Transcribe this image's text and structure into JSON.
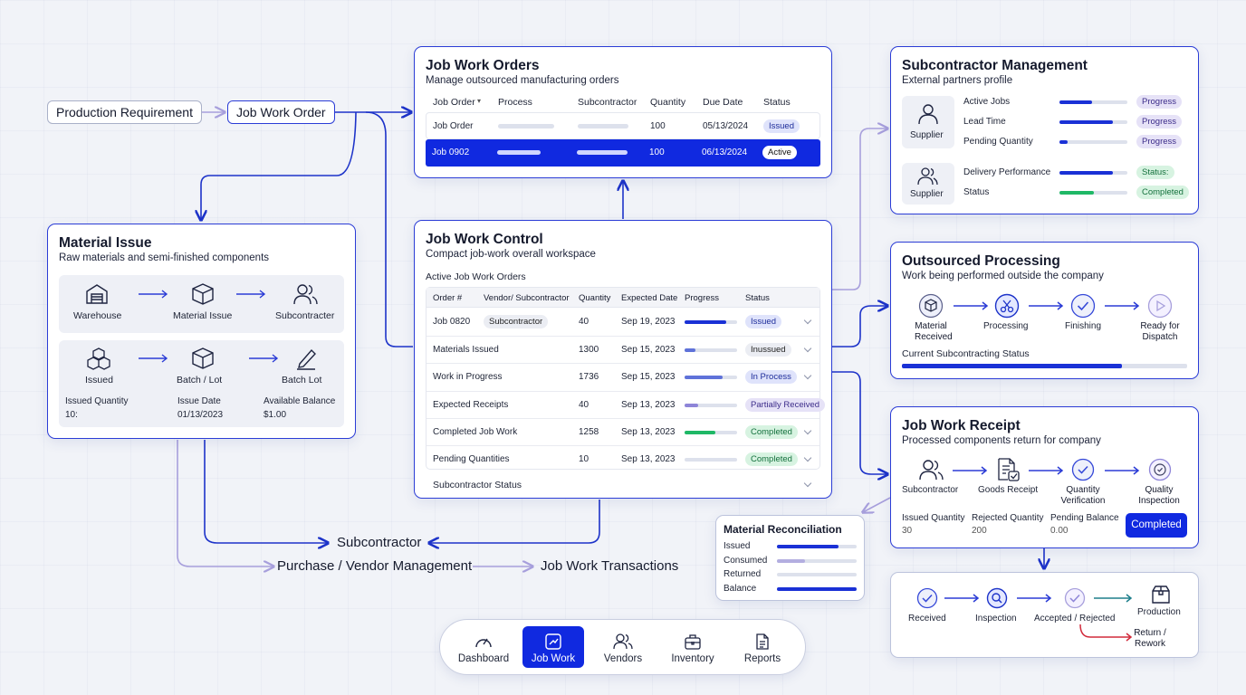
{
  "flow": {
    "production_requirement": "Production Requirement",
    "job_work_order": "Job Work Order",
    "subcontractor": "Subcontractor",
    "purchase_vendor": "Purchase / Vendor Management",
    "job_work_transactions": "Job Work Transactions"
  },
  "job_orders": {
    "title": "Job Work Orders",
    "subtitle": "Manage outsourced manufacturing orders",
    "headers": [
      "Job Order",
      "Process",
      "Subcontractor",
      "Quantity",
      "Due Date",
      "Status"
    ],
    "rows": [
      {
        "order": "Job Order",
        "qty": "100",
        "due": "05/13/2024",
        "status": "Issued"
      },
      {
        "order": "Job 0902",
        "qty": "100",
        "due": "06/13/2024",
        "status": "Active"
      }
    ]
  },
  "material_issue": {
    "title": "Material Issue",
    "subtitle": "Raw materials and semi-finished components",
    "flow1": [
      "Warehouse",
      "Material Issue",
      "Subcontracter"
    ],
    "flow2": [
      "Issued",
      "Batch / Lot",
      "Batch Lot"
    ],
    "fields": [
      {
        "label": "Issued Quantity",
        "value": "10:"
      },
      {
        "label": "Issue Date",
        "value": "01/13/2023"
      },
      {
        "label": "Available Balance",
        "value": "$1.00"
      }
    ]
  },
  "control": {
    "title": "Job Work Control",
    "subtitle": "Compact job-work overall workspace",
    "section": "Active Job Work Orders",
    "headers": [
      "Order #",
      "Vendor/ Subcontractor",
      "Quantity",
      "Expected Date",
      "Progress",
      "Status"
    ],
    "rows": [
      {
        "order": "Job 0820",
        "vendor": "Subcontractor",
        "qty": "40",
        "date": "Sep 19, 2023",
        "progress": 0.8,
        "status": "Issued"
      },
      {
        "order": "Materials Issued",
        "vendor": "",
        "qty": "1300",
        "date": "Sep 15, 2023",
        "progress": 0.2,
        "status": "Inussued"
      },
      {
        "order": "Work in Progress",
        "vendor": "",
        "qty": "1736",
        "date": "Sep 15, 2023",
        "progress": 0.72,
        "status": "In Process"
      },
      {
        "order": "Expected Receipts",
        "vendor": "",
        "qty": "40",
        "date": "Sep 13, 2023",
        "progress": 0.25,
        "status": "Partially Received"
      },
      {
        "order": "Completed Job Work",
        "vendor": "",
        "qty": "1258",
        "date": "Sep 13, 2023",
        "progress": 0.58,
        "status": "Completed"
      },
      {
        "order": "Pending Quantities",
        "vendor": "",
        "qty": "10",
        "date": "Sep 13, 2023",
        "progress": 0,
        "status": "Completed"
      }
    ],
    "footer": "Subcontractor Status"
  },
  "subcontractor_mgmt": {
    "title": "Subcontractor Management",
    "subtitle": "External partners profile",
    "supplier_label": "Supplier",
    "metrics": [
      {
        "label": "Active Jobs",
        "progress": 0.48,
        "status": "Progress"
      },
      {
        "label": "Lead Time",
        "progress": 0.78,
        "status": "Progress"
      },
      {
        "label": "Pending Quantity",
        "progress": 0.12,
        "status": "Progress"
      },
      {
        "label": "Delivery Performance",
        "progress": 0.78,
        "status": "Status:"
      },
      {
        "label": "Status",
        "progress": 0.5,
        "status": "Completed"
      }
    ]
  },
  "outsourced": {
    "title": "Outsourced Processing",
    "subtitle": "Work being performed outside the company",
    "steps": [
      "Material Received",
      "Processing",
      "Finishing",
      "Ready for Dispatch"
    ],
    "status_label": "Current Subcontracting Status",
    "status_progress": 0.77
  },
  "receipt": {
    "title": "Job Work Receipt",
    "subtitle": "Processed components return for company",
    "steps": [
      "Subcontractor",
      "Goods Receipt",
      "Quantity Verification",
      "Quality Inspection"
    ],
    "fields": [
      {
        "label": "Issued Quantity",
        "value": "30"
      },
      {
        "label": "Rejected Quantity",
        "value": "200"
      },
      {
        "label": "Pending Balance",
        "value": "0.00"
      }
    ],
    "button": "Completed"
  },
  "reconciliation": {
    "title": "Material Reconciliation",
    "rows": [
      {
        "label": "Issued",
        "value": 0.77
      },
      {
        "label": "Consumed",
        "value": 0.35
      },
      {
        "label": "Returned",
        "value": 0
      },
      {
        "label": "Balance",
        "value": 1
      }
    ]
  },
  "quality": {
    "steps": [
      "Received",
      "Inspection",
      "Accepted / Rejected",
      "Production"
    ],
    "return_label": "Return / Rework"
  },
  "nav": {
    "items": [
      "Dashboard",
      "Job Work",
      "Vendors",
      "Inventory",
      "Reports"
    ],
    "active": "Job Work"
  },
  "colors": {
    "accent": "#1029e0",
    "green": "#1fb866",
    "purple": "#8e85d8",
    "red": "#d22b3c"
  }
}
